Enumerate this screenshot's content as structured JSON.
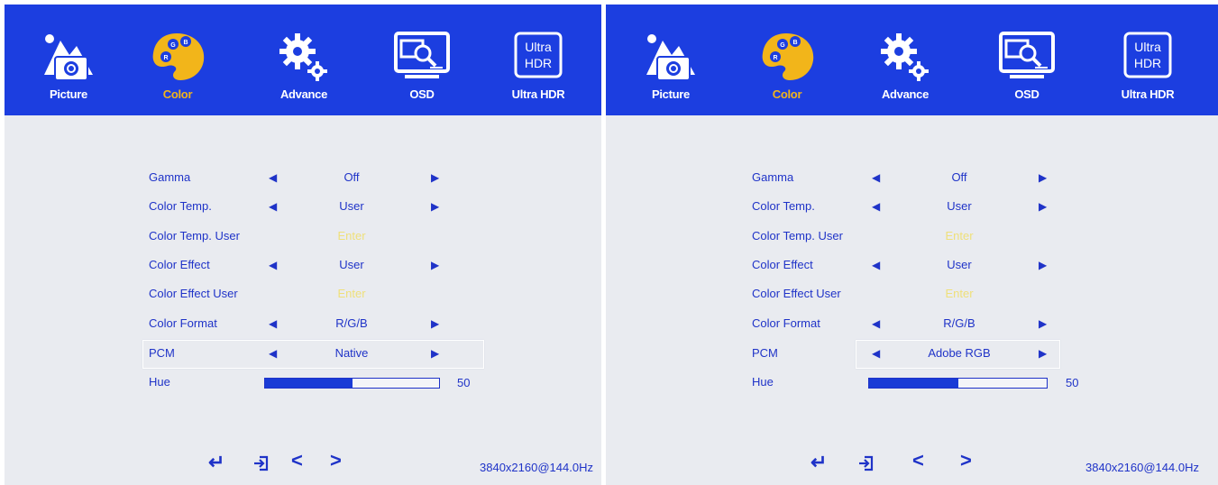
{
  "tabs": [
    {
      "label": "Picture"
    },
    {
      "label": "Color"
    },
    {
      "label": "Advance"
    },
    {
      "label": "OSD"
    },
    {
      "label": "Ultra HDR",
      "icon_text_1": "Ultra",
      "icon_text_2": "HDR"
    }
  ],
  "left": {
    "rows": {
      "gamma": {
        "label": "Gamma",
        "value": "Off"
      },
      "color_temp": {
        "label": "Color Temp.",
        "value": "User"
      },
      "color_temp_user": {
        "label": "Color Temp. User",
        "value": "Enter"
      },
      "color_effect": {
        "label": "Color Effect",
        "value": "User"
      },
      "color_effect_user": {
        "label": "Color Effect User",
        "value": "Enter"
      },
      "color_format": {
        "label": "Color Format",
        "value": "R/G/B"
      },
      "pcm": {
        "label": "PCM",
        "value": "Native"
      },
      "hue": {
        "label": "Hue",
        "value": "50",
        "level": 0.5
      }
    },
    "resolution": "3840x2160@144.0Hz"
  },
  "right": {
    "rows": {
      "gamma": {
        "label": "Gamma",
        "value": "Off"
      },
      "color_temp": {
        "label": "Color Temp.",
        "value": "User"
      },
      "color_temp_user": {
        "label": "Color Temp. User",
        "value": "Enter"
      },
      "color_effect": {
        "label": "Color Effect",
        "value": "User"
      },
      "color_effect_user": {
        "label": "Color Effect User",
        "value": "Enter"
      },
      "color_format": {
        "label": "Color Format",
        "value": "R/G/B"
      },
      "pcm": {
        "label": "PCM",
        "value": "Adobe RGB"
      },
      "hue": {
        "label": "Hue",
        "value": "50",
        "level": 0.5
      }
    },
    "resolution": "3840x2160@144.0Hz"
  },
  "icons": {
    "picture": "picture-icon",
    "color": "palette-icon",
    "advance": "gear-icon",
    "osd": "monitor-search-icon",
    "ultra_hdr": "ultra-hdr-icon",
    "enter": "enter-icon",
    "exit": "exit-icon",
    "prev": "chevron-left-icon",
    "next": "chevron-right-icon",
    "arrow_left": "triangle-left-icon",
    "arrow_right": "triangle-right-icon"
  },
  "colors": {
    "header": "#1c3ee0",
    "background": "#e9ebf0",
    "text": "#1f33c8",
    "active_tab": "#f2b51a",
    "enter_text": "#efe07a"
  }
}
